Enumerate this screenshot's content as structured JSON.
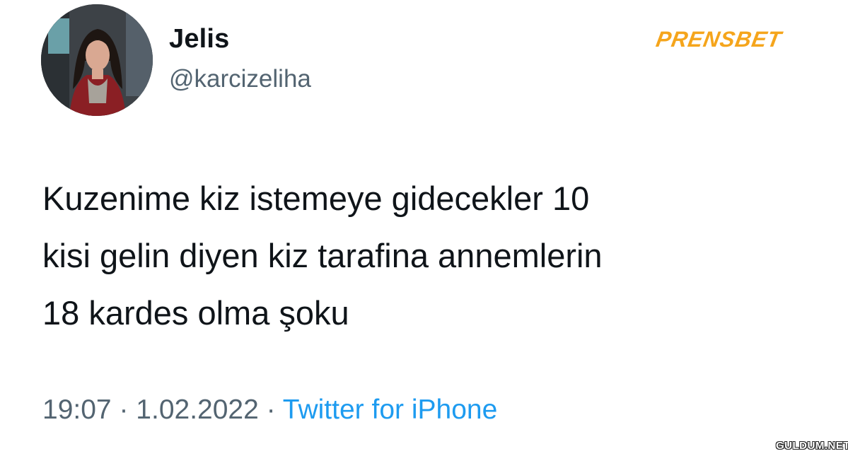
{
  "tweet": {
    "author": {
      "display_name": "Jelis",
      "handle": "@karcizeliha"
    },
    "text_lines": [
      "Kuzenime kiz istemeye gidecekler 10",
      "kisi gelin diyen kiz tarafina annemlerin",
      "18 kardes olma şoku"
    ],
    "time": "19:07",
    "separator": "·",
    "date": "1.02.2022",
    "source": "Twitter for iPhone"
  },
  "overlays": {
    "brand_logo": "PRENSBET",
    "watermark": "GULDUM.NET"
  },
  "colors": {
    "text_primary": "#0f1419",
    "text_secondary": "#536471",
    "link": "#1d9bf0",
    "brand": "#f5a51c"
  }
}
